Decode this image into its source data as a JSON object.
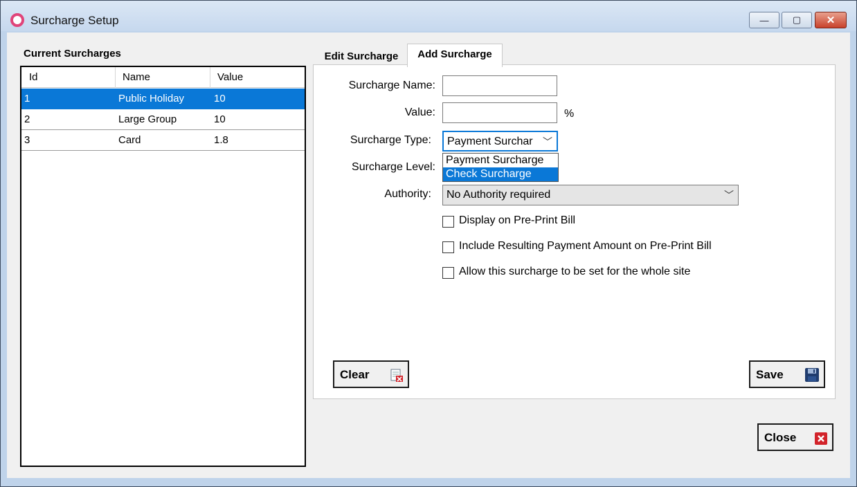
{
  "window": {
    "title": "Surcharge Setup",
    "minimize": "—",
    "maximize": "▢",
    "close": "✕"
  },
  "current": {
    "title": "Current Surcharges",
    "columns": [
      "Id",
      "Name",
      "Value"
    ],
    "rows": [
      {
        "id": "1",
        "name": "Public Holiday",
        "value": "10",
        "selected": true
      },
      {
        "id": "2",
        "name": "Large Group",
        "value": "10",
        "selected": false
      },
      {
        "id": "3",
        "name": "Card",
        "value": "1.8",
        "selected": false
      }
    ]
  },
  "tabs": {
    "edit": "Edit Surcharge",
    "add": "Add Surcharge",
    "active": "add"
  },
  "form": {
    "name_label": "Surcharge Name:",
    "name_value": "",
    "value_label": "Value:",
    "value_value": "",
    "percent": "%",
    "type_label": "Surcharge Type:",
    "type_selected": "Payment Surchar",
    "type_options": [
      "Payment Surcharge",
      "Check Surcharge"
    ],
    "type_highlighted": "Check Surcharge",
    "level_label": "Surcharge Level:",
    "authority_label": "Authority:",
    "authority_selected": "No Authority required",
    "checkboxes": [
      {
        "label": "Display on Pre-Print Bill",
        "checked": false
      },
      {
        "label": "Include Resulting Payment Amount on Pre-Print Bill",
        "checked": false
      },
      {
        "label": "Allow this surcharge to be set for the whole site",
        "checked": false
      }
    ]
  },
  "buttons": {
    "clear": "Clear",
    "save": "Save",
    "close": "Close"
  },
  "colors": {
    "selection": "#0a78d7",
    "window_frame": "#bfd3ea",
    "accent_icon": "#e0447a",
    "close_icon": "#d2232a",
    "save_icon": "#1f3c6e"
  }
}
